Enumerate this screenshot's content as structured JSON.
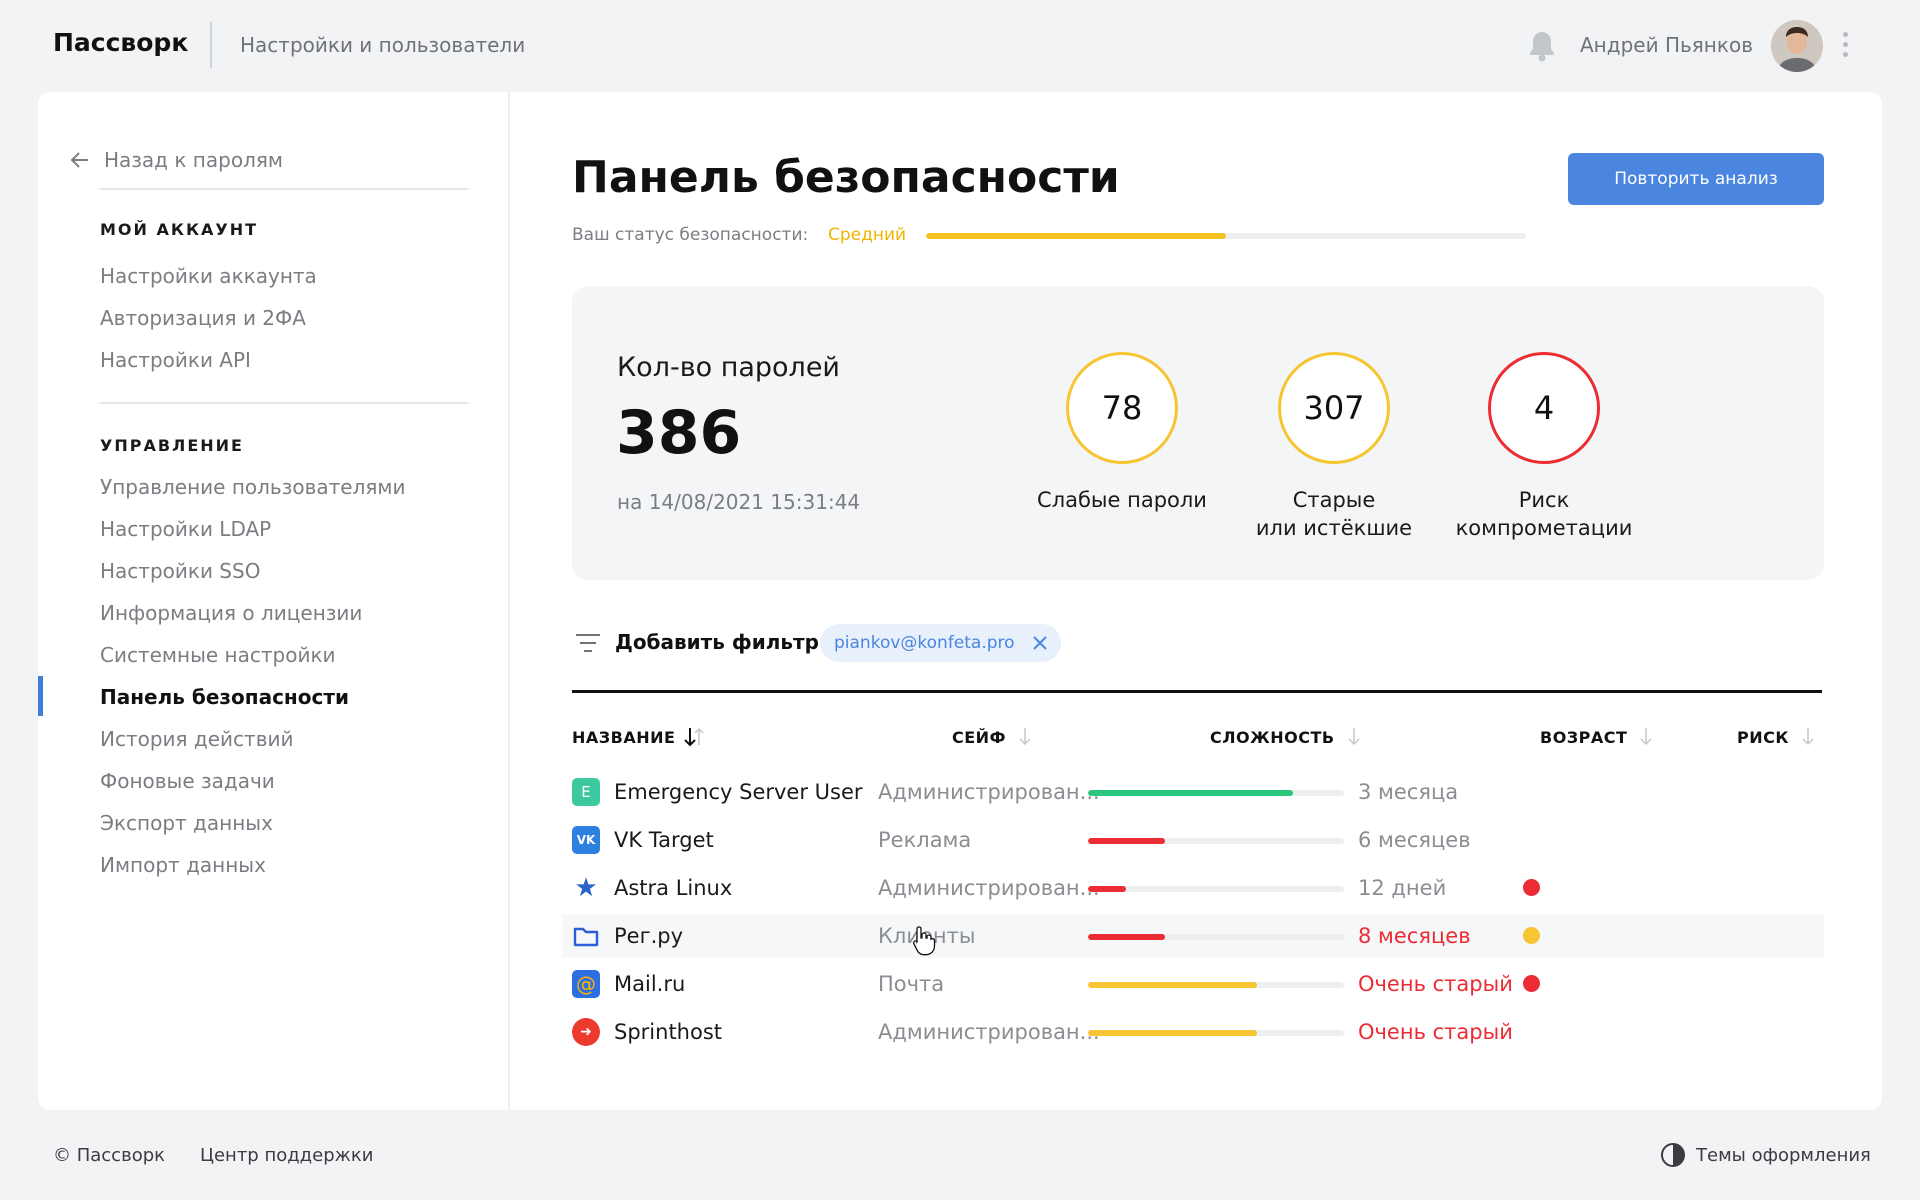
{
  "header": {
    "brand": "Пассворк",
    "section": "Настройки и пользователи",
    "user_name": "Андрей Пьянков"
  },
  "sidebar": {
    "back_label": "Назад к паролям",
    "account_heading": "МОЙ АККАУНТ",
    "account_items": [
      "Настройки аккаунта",
      "Авторизация и 2ФА",
      "Настройки API"
    ],
    "manage_heading": "УПРАВЛЕНИЕ",
    "manage_items": [
      "Управление пользователями",
      "Настройки LDAP",
      "Настройки SSO",
      "Информация о лицензии",
      "Системные настройки",
      "Панель безопасности",
      "История действий",
      "Фоновые задачи",
      "Экспорт данных",
      "Импорт данных"
    ],
    "active_item": "Панель безопасности"
  },
  "main": {
    "title": "Панель безопасности",
    "repeat_button": "Повторить анализ",
    "status_label": "Ваш статус безопасности:",
    "status_value": "Средний",
    "status_level": 0.5
  },
  "stats": {
    "count_label": "Кол-во паролей",
    "count_value": "386",
    "count_date": "на 14/08/2021 15:31:44",
    "metrics": [
      {
        "value": "78",
        "label": "Слабые пароли",
        "color": "#f6c531"
      },
      {
        "value": "307",
        "label": "Старые\nили истёкшие",
        "color": "#f6c531"
      },
      {
        "value": "4",
        "label": "Риск\nкомпрометации",
        "color": "#ec2c35"
      }
    ]
  },
  "filter": {
    "add_label": "Добавить фильтр",
    "chip_label": "piankov@konfeta.pro"
  },
  "table": {
    "columns": [
      "НАЗВАНИЕ",
      "СЕЙФ",
      "СЛОЖНОСТЬ",
      "ВОЗРАСТ",
      "РИСК"
    ],
    "rows": [
      {
        "name": "Emergency Server User",
        "icon": "letter-e-icon",
        "icon_text": "E",
        "icon_bg": "#3ec8a0",
        "safe": "Администрирован...",
        "complexity": 0.8,
        "complexity_color": "#2bc77c",
        "age": "3 месяца",
        "age_warn": false,
        "risk": null
      },
      {
        "name": "VK Target",
        "icon": "vk-icon",
        "icon_text": "VK",
        "icon_bg": "#2d7fe0",
        "safe": "Реклама",
        "complexity": 0.3,
        "complexity_color": "#ec2c35",
        "age": "6 месяцев",
        "age_warn": false,
        "risk": null
      },
      {
        "name": "Astra Linux",
        "icon": "star-icon",
        "icon_text": "★",
        "icon_bg": "transparent",
        "safe": "Администрирован...",
        "complexity": 0.15,
        "complexity_color": "#ec2c35",
        "age": "12 дней",
        "age_warn": false,
        "risk": "#ec2c35"
      },
      {
        "name": "Рег.ру",
        "icon": "folder-icon",
        "icon_text": "",
        "icon_bg": "transparent",
        "safe": "Клиенты",
        "complexity": 0.3,
        "complexity_color": "#ec2c35",
        "age": "8 месяцев",
        "age_warn": true,
        "risk": "#f6c531"
      },
      {
        "name": "Mail.ru",
        "icon": "at-icon",
        "icon_text": "@",
        "icon_bg": "#2d6fe0",
        "safe": "Почта",
        "complexity": 0.66,
        "complexity_color": "#f6c531",
        "age": "Очень старый",
        "age_warn": true,
        "risk": "#ec2c35"
      },
      {
        "name": "Sprinthost",
        "icon": "rocket-icon",
        "icon_text": "➜",
        "icon_bg": "#ec3b2c",
        "safe": "Администрирован...",
        "complexity": 0.66,
        "complexity_color": "#f6c531",
        "age": "Очень старый",
        "age_warn": true,
        "risk": null
      }
    ]
  },
  "footer": {
    "copyright": "© Пассворк",
    "support": "Центр поддержки",
    "themes": "Темы оформления"
  }
}
